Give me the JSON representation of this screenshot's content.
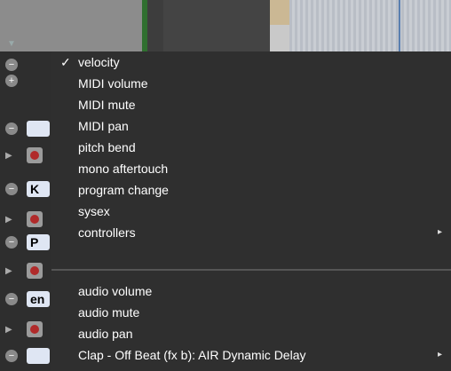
{
  "menu": {
    "checked_mark": "✓",
    "submenu_arrow": "▸",
    "items": [
      {
        "label": "velocity",
        "checked": true
      },
      {
        "label": "MIDI volume"
      },
      {
        "label": "MIDI mute"
      },
      {
        "label": "MIDI pan"
      },
      {
        "label": "pitch bend"
      },
      {
        "label": "mono aftertouch"
      },
      {
        "label": "program change"
      },
      {
        "label": "sysex"
      },
      {
        "label": "controllers",
        "submenu": true
      }
    ],
    "audio_items": [
      {
        "label": "audio volume"
      },
      {
        "label": "audio mute"
      },
      {
        "label": "audio pan"
      },
      {
        "label": "Clap - Off Beat  (fx b): AIR Dynamic Delay",
        "submenu": true
      }
    ]
  },
  "side_labels": {
    "row_a": "K",
    "row_b": "P",
    "row_c": "en"
  },
  "icons": {
    "minus": "−",
    "plus": "+",
    "play": "▶",
    "down": "▼"
  }
}
